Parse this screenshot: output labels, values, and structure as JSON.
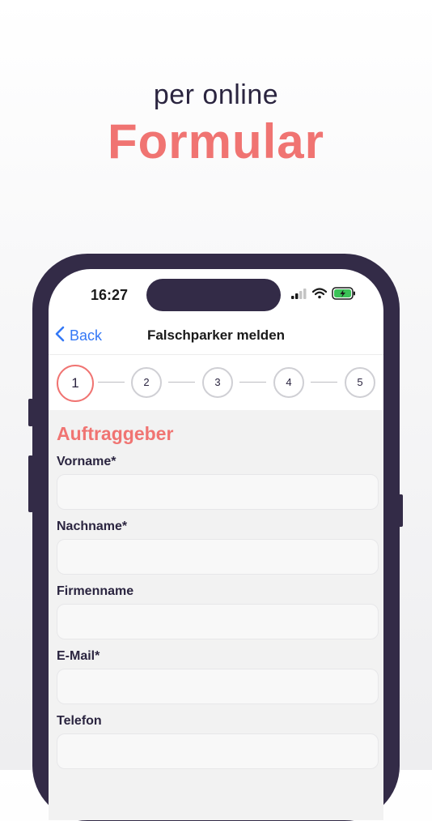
{
  "promo": {
    "subtitle": "per online",
    "title": "Formular"
  },
  "status_bar": {
    "time": "16:27"
  },
  "nav": {
    "back_label": "Back",
    "title": "Falschparker melden"
  },
  "steps": [
    "1",
    "2",
    "3",
    "4",
    "5"
  ],
  "active_step": 1,
  "form": {
    "section_title": "Auftraggeber",
    "fields": [
      {
        "label": "Vorname*",
        "value": ""
      },
      {
        "label": "Nachname*",
        "value": ""
      },
      {
        "label": "Firmenname",
        "value": ""
      },
      {
        "label": "E-Mail*",
        "value": ""
      },
      {
        "label": "Telefon",
        "value": ""
      }
    ]
  },
  "colors": {
    "accent": "#f07472",
    "phone_frame": "#332b47",
    "link": "#3478f6"
  }
}
